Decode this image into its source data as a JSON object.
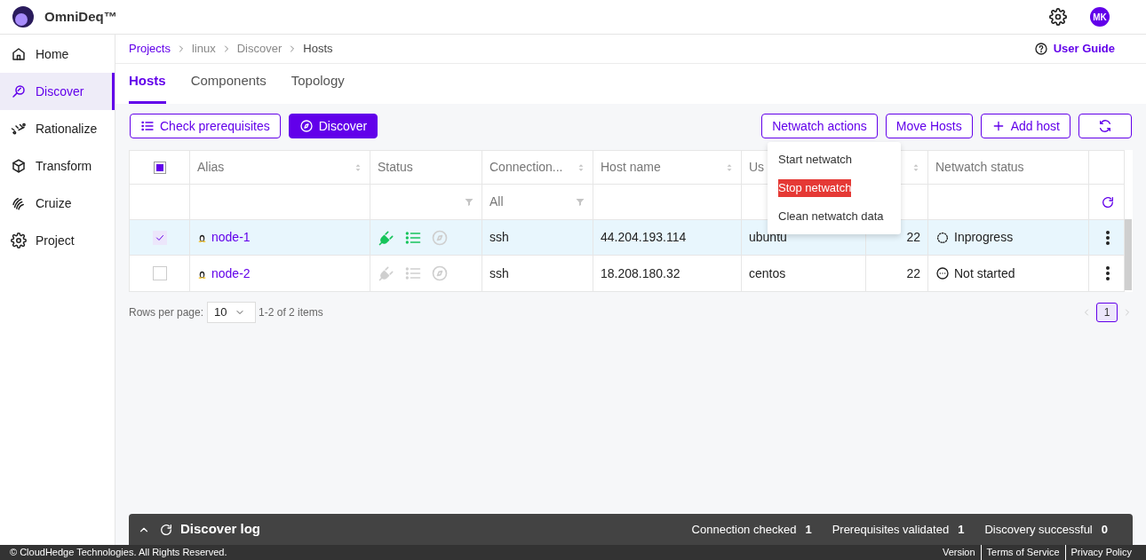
{
  "app": {
    "name": "OmniDeq™",
    "avatar": "MK"
  },
  "sidebar": {
    "items": [
      {
        "label": "Home",
        "selected": false
      },
      {
        "label": "Discover",
        "selected": true
      },
      {
        "label": "Rationalize",
        "selected": false
      },
      {
        "label": "Transform",
        "selected": false
      },
      {
        "label": "Cruize",
        "selected": false
      },
      {
        "label": "Project",
        "selected": false
      }
    ]
  },
  "breadcrumb": [
    {
      "label": "Projects",
      "kind": "link"
    },
    {
      "label": "linux",
      "kind": "muted"
    },
    {
      "label": "Discover",
      "kind": "muted"
    },
    {
      "label": "Hosts",
      "kind": "current"
    }
  ],
  "user_guide": "User Guide",
  "tabs": [
    {
      "label": "Hosts",
      "selected": true
    },
    {
      "label": "Components",
      "selected": false
    },
    {
      "label": "Topology",
      "selected": false
    }
  ],
  "toolbar_left": [
    {
      "label": "Check prerequisites",
      "kind": "outline"
    },
    {
      "label": "Discover",
      "kind": "solid"
    }
  ],
  "toolbar_right": [
    {
      "label": "Netwatch actions"
    },
    {
      "label": "Move Hosts"
    },
    {
      "label": "Add host"
    }
  ],
  "menu": {
    "items": [
      {
        "label": "Start netwatch",
        "highlighted": false
      },
      {
        "label": "Stop netwatch",
        "highlighted": true
      },
      {
        "label": "Clean netwatch data",
        "highlighted": false
      }
    ]
  },
  "table": {
    "header_checkbox": {
      "indeterminate": true
    },
    "columns": [
      {
        "label": "Alias",
        "sortable": true
      },
      {
        "label": "Status",
        "filterable": true
      },
      {
        "label": "Connection...",
        "sortable": true,
        "filterable": true,
        "filter": "All"
      },
      {
        "label": "Host name",
        "sortable": true
      },
      {
        "label": "Us"
      },
      {
        "sortable": true
      },
      {
        "label": "Netwatch status"
      }
    ],
    "rows": [
      {
        "selected": true,
        "alias": "node-1",
        "connected": true,
        "prerequisites": true,
        "discovered": false,
        "connection": "ssh",
        "host": "44.204.193.114",
        "user": "ubuntu",
        "port": "22",
        "netwatch": {
          "kind": "inprogress",
          "label": "Inprogress"
        }
      },
      {
        "selected": false,
        "alias": "node-2",
        "connected": false,
        "prerequisites": false,
        "discovered": false,
        "connection": "ssh",
        "host": "18.208.180.32",
        "user": "centos",
        "port": "22",
        "netwatch": {
          "kind": "notstarted",
          "label": "Not started"
        }
      }
    ]
  },
  "pagination": {
    "rows_label": "Rows per page:",
    "rows_per_page": "10",
    "range": "1-2 of 2 items",
    "pages": [
      {
        "label": "1",
        "selected": true
      }
    ]
  },
  "discover_log": {
    "title": "Discover log",
    "stats": [
      {
        "label": "Connection checked",
        "value": "1"
      },
      {
        "label": "Prerequisites validated",
        "value": "1"
      },
      {
        "label": "Discovery successful",
        "value": "0"
      }
    ]
  },
  "footer": {
    "copyright": "© CloudHedge Technologies. All Rights Reserved.",
    "links": [
      "Version",
      "Terms of Service",
      "Privacy Policy"
    ]
  }
}
